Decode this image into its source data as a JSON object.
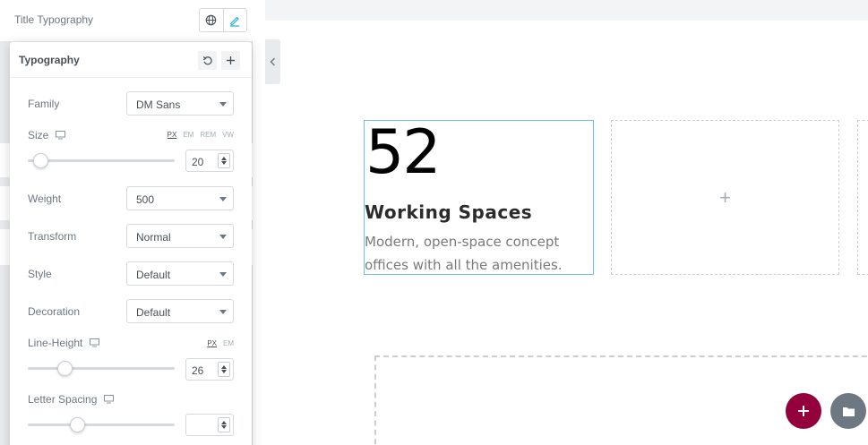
{
  "panel": {
    "control_label": "Title Typography"
  },
  "popover": {
    "title": "Typography",
    "family": {
      "label": "Family",
      "value": "DM Sans"
    },
    "size": {
      "label": "Size",
      "units": [
        "PX",
        "EM",
        "REM",
        "VW"
      ],
      "active_unit": "PX",
      "value": "20",
      "slider_fraction": 0.09
    },
    "weight": {
      "label": "Weight",
      "value": "500"
    },
    "transform": {
      "label": "Transform",
      "value": "Normal"
    },
    "style": {
      "label": "Style",
      "value": "Default"
    },
    "decoration": {
      "label": "Decoration",
      "value": "Default"
    },
    "line_height": {
      "label": "Line-Height",
      "units": [
        "PX",
        "EM"
      ],
      "active_unit": "PX",
      "value": "26",
      "slider_fraction": 0.25
    },
    "letter_spacing": {
      "label": "Letter Spacing",
      "value": "",
      "slider_fraction": 0.34
    }
  },
  "preview": {
    "counter_number": "52",
    "counter_title": "Working Spaces",
    "counter_description": "Modern, open-space concept offices with all the amenities.",
    "empty_column_plus": "+"
  },
  "colors": {
    "accent_add": "#93003c",
    "folder_button": "#6d7882",
    "widget_outline": "#6ec1d6"
  },
  "icons": [
    "globe-icon",
    "pencil-icon",
    "reset-icon",
    "plus-icon",
    "desktop-icon",
    "chevron-left-icon",
    "folder-icon"
  ]
}
